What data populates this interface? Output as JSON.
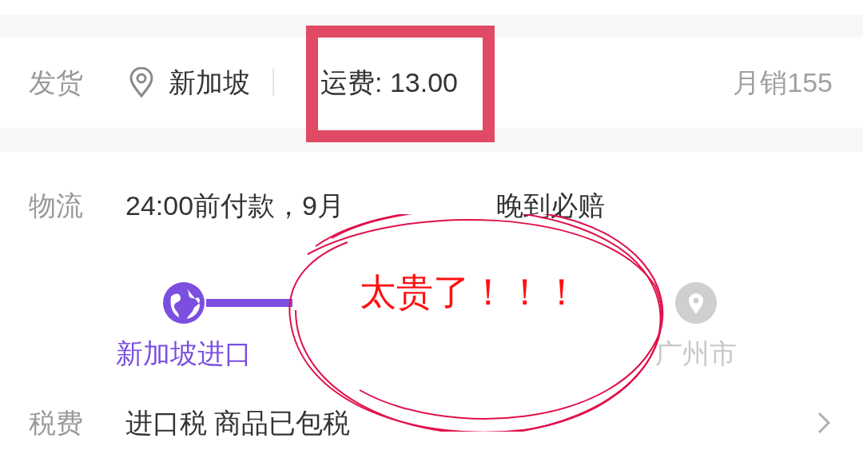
{
  "shipping": {
    "label": "发货",
    "origin": "新加坡",
    "fee": "运费: 13.00",
    "monthly_sales": "月销155"
  },
  "logistics": {
    "label": "物流",
    "promise_parts": [
      "24:00前付款，9月",
      "晚到必赔"
    ],
    "steps": [
      {
        "label": "新加坡进口",
        "kind": "globe",
        "selected": true
      },
      {
        "label": "广州市",
        "kind": "pin",
        "selected": false
      }
    ]
  },
  "tax": {
    "label": "税费",
    "value": "进口税 商品已包税"
  },
  "annotation": {
    "note": "太贵了！！！"
  }
}
